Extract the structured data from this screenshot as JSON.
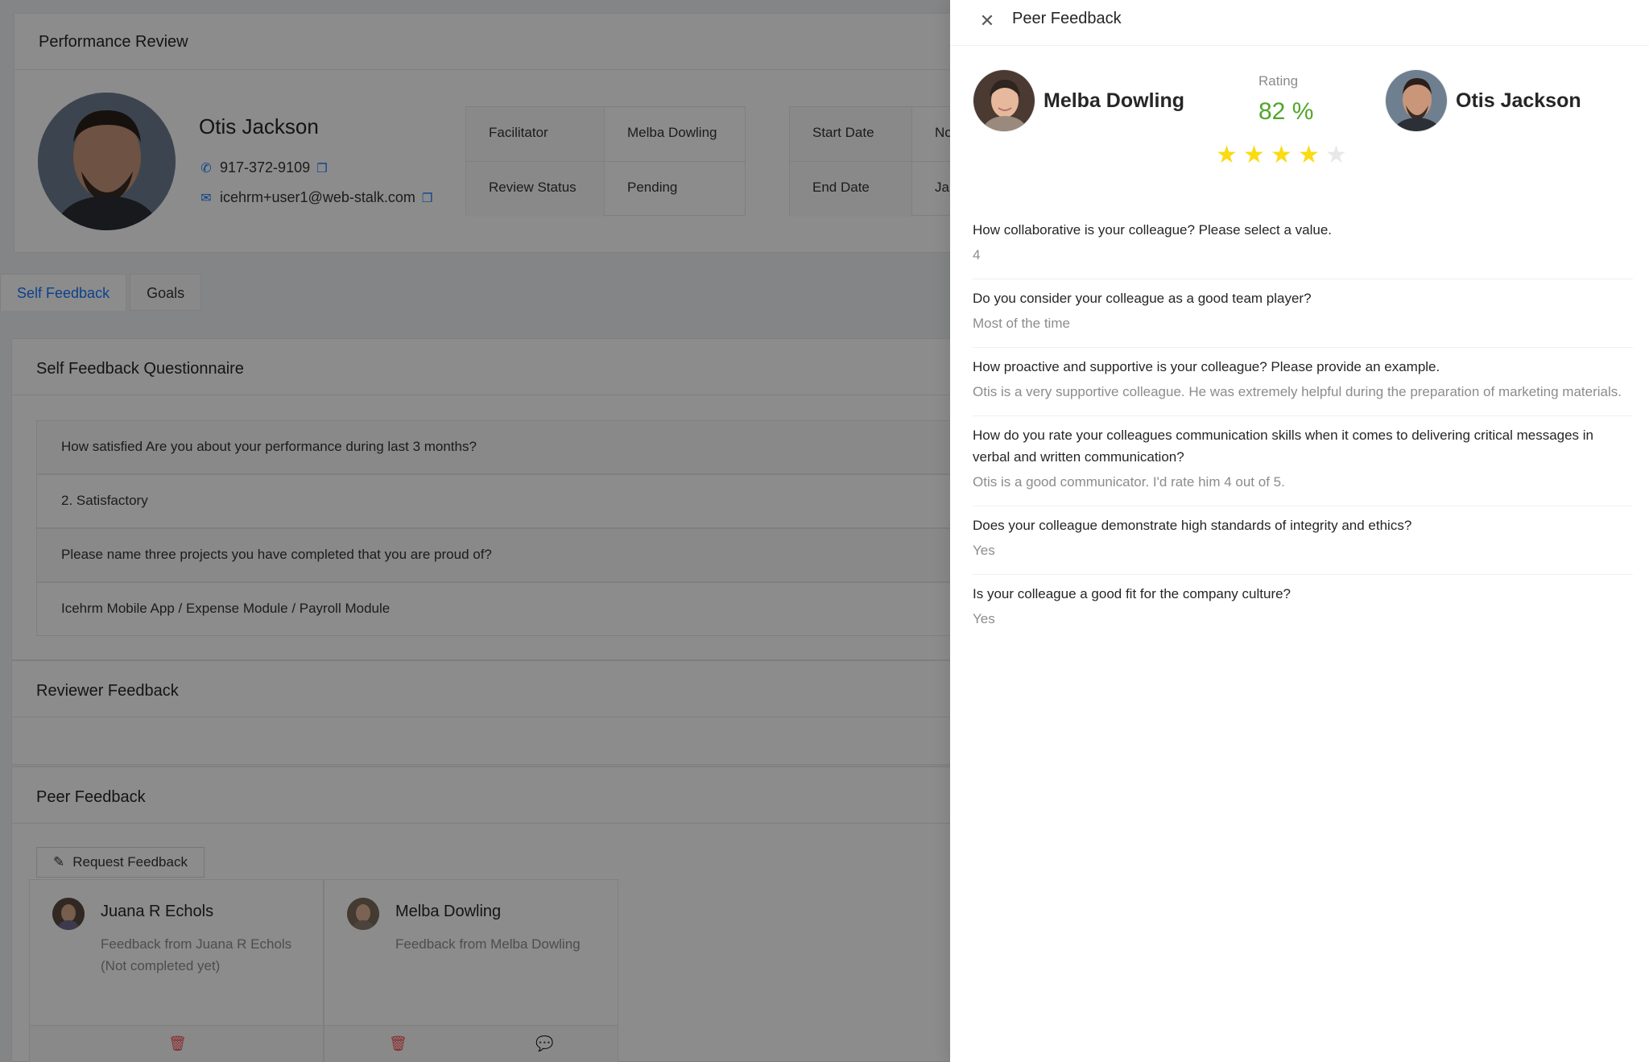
{
  "review": {
    "title": "Performance Review",
    "employee": {
      "name": "Otis Jackson",
      "phone": "917-372-9109",
      "email": "icehrm+user1@web-stalk.com"
    },
    "details": [
      {
        "label": "Facilitator",
        "value": "Melba Dowling"
      },
      {
        "label": "Review Status",
        "value": "Pending"
      }
    ],
    "dates": [
      {
        "label": "Start Date",
        "value": "Nov"
      },
      {
        "label": "End Date",
        "value": "Jan"
      }
    ]
  },
  "tabs": [
    {
      "label": "Self Feedback",
      "active": true
    },
    {
      "label": "Goals",
      "active": false
    }
  ],
  "self_feedback": {
    "title": "Self Feedback Questionnaire",
    "rows": [
      "How satisfied Are you about your performance during last 3 months?",
      "2. Satisfactory",
      "Please name three projects you have completed that you are proud of?",
      "Icehrm Mobile App / Expense Module / Payroll Module"
    ]
  },
  "reviewer_feedback": {
    "title": "Reviewer Feedback"
  },
  "peer_feedback": {
    "title": "Peer Feedback",
    "request_button": "Request Feedback",
    "cards": [
      {
        "name": "Juana R Echols",
        "desc": "Feedback from Juana R Echols (Not completed yet)"
      },
      {
        "name": "Melba Dowling",
        "desc": "Feedback from Melba Dowling"
      }
    ]
  },
  "drawer": {
    "title": "Peer Feedback",
    "reviewer": {
      "name": "Melba Dowling"
    },
    "reviewee": {
      "name": "Otis Jackson"
    },
    "rating_label": "Rating",
    "rating_value": "82 %",
    "stars": 4,
    "stars_max": 5,
    "accent_color": "#52a52a",
    "items": [
      {
        "q": "How collaborative is your colleague? Please select a value.",
        "a": "4"
      },
      {
        "q": "Do you consider your colleague as a good team player?",
        "a": "Most of the time"
      },
      {
        "q": "How proactive and supportive is your colleague? Please provide an example.",
        "a": "Otis is a very supportive colleague. He was extremely helpful during the preparation of marketing materials."
      },
      {
        "q": "How do you rate your colleagues communication skills when it comes to delivering critical messages in verbal and written communication?",
        "a": "Otis is a good communicator. I'd rate him 4 out of 5."
      },
      {
        "q": "Does your colleague demonstrate high standards of integrity and ethics?",
        "a": "Yes"
      },
      {
        "q": "Is your colleague a good fit for the company culture?",
        "a": "Yes"
      }
    ]
  }
}
